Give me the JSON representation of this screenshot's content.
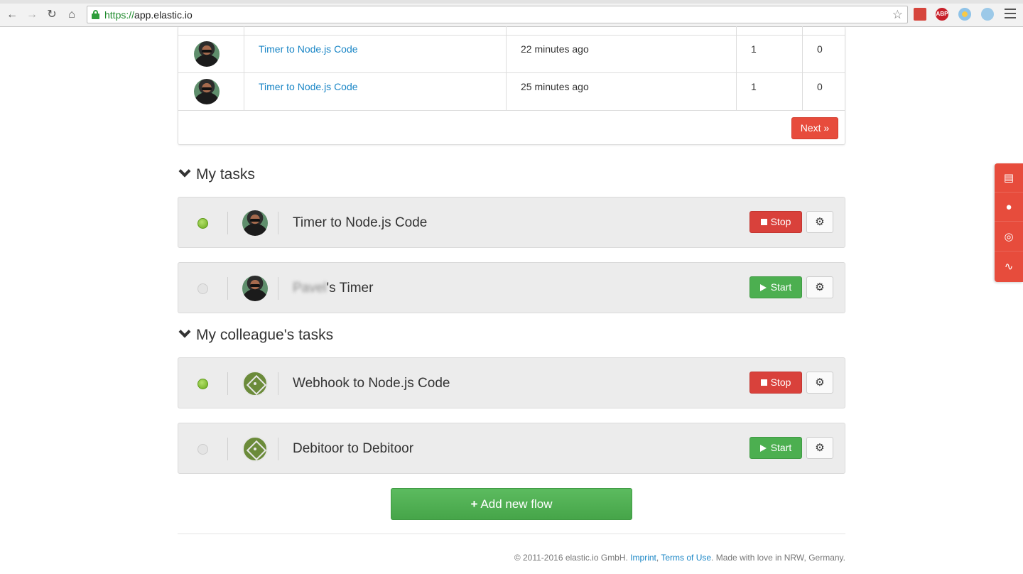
{
  "browser": {
    "url_scheme": "https://",
    "url_host": "app.elastic.io",
    "extensions": [
      "bookmark-extension-icon",
      "adblock-extension-icon",
      "flower-extension-icon",
      "glasses-extension-icon"
    ],
    "adblock_label": "ABP"
  },
  "activity": {
    "rows": [
      {
        "flow": "Timer to Node.js Code",
        "time": "22 minutes ago",
        "count_a": "1",
        "count_b": "0"
      },
      {
        "flow": "Timer to Node.js Code",
        "time": "25 minutes ago",
        "count_a": "1",
        "count_b": "0"
      }
    ],
    "next_label": "Next »"
  },
  "my_tasks": {
    "title": "My tasks",
    "items": [
      {
        "name": "Timer to Node.js Code",
        "status": "running",
        "action": "Stop"
      },
      {
        "name_blurred": "Pavel",
        "name_suffix": "'s Timer",
        "status": "stopped",
        "action": "Start"
      }
    ]
  },
  "colleague_tasks": {
    "title": "My colleague's tasks",
    "items": [
      {
        "name": "Webhook to Node.js Code",
        "status": "running",
        "action": "Stop"
      },
      {
        "name": "Debitoor to Debitoor",
        "status": "stopped",
        "action": "Start"
      }
    ]
  },
  "add_flow_label": "Add new flow",
  "footer": {
    "copyright": "© 2011-2016 elastic.io GmbH.",
    "imprint": "Imprint",
    "sep": ",",
    "terms": "Terms of Use",
    "tagline": ". Made with love in NRW, Germany."
  },
  "side_widget": {
    "items": [
      "book-icon",
      "chat-icon",
      "support-icon",
      "rss-icon"
    ]
  },
  "colors": {
    "accent_red": "#e74c3c",
    "start_green": "#4caf50",
    "link_blue": "#1a86c6"
  }
}
